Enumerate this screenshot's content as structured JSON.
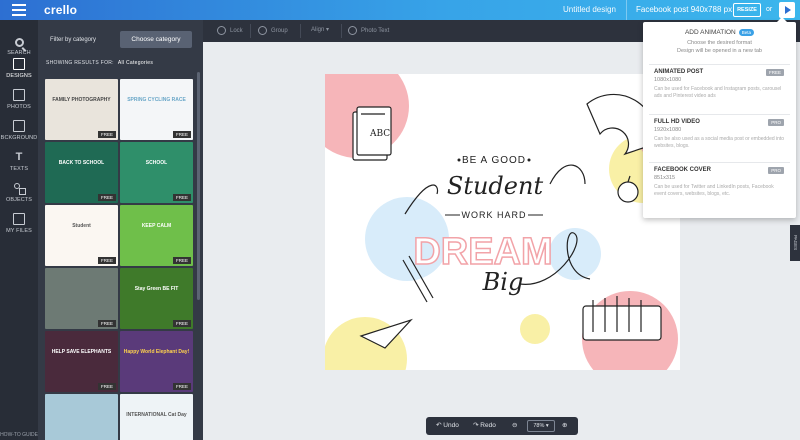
{
  "topbar": {
    "logo": "crello",
    "document_title": "Untitled design",
    "format": "Facebook post 940x788 px",
    "resize_label": "RESIZE",
    "or_label": "or"
  },
  "nav": [
    {
      "label": "SEARCH",
      "icon": "search-icon"
    },
    {
      "label": "DESIGNS",
      "icon": "designs-icon"
    },
    {
      "label": "PHOTOS",
      "icon": "photos-icon"
    },
    {
      "label": "BCKGROUND",
      "icon": "background-icon"
    },
    {
      "label": "TEXTS",
      "icon": "text-icon"
    },
    {
      "label": "OBJECTS",
      "icon": "objects-icon"
    },
    {
      "label": "MY FILES",
      "icon": "folder-icon"
    }
  ],
  "howto": "HOW-TO GUIDE",
  "panel": {
    "filter_label": "Filter by category",
    "choose_button": "Choose category",
    "results_label": "SHOWING RESULTS FOR:",
    "results_value": "All Categories",
    "free_badge": "FREE",
    "tiles": [
      {
        "text": "FAMILY PHOTOGRAPHY",
        "bg": "#e9e4dc",
        "fg": "#444"
      },
      {
        "text": "SPRING CYCLING RACE",
        "bg": "#f4f6f8",
        "fg": "#6aa7c8"
      },
      {
        "text": "BACK TO SCHOOL",
        "bg": "#1f6a54",
        "fg": "#ffffff"
      },
      {
        "text": "SCHOOL",
        "bg": "#2f8f6a",
        "fg": "#ffffff"
      },
      {
        "text": "Student",
        "bg": "#fbf7f2",
        "fg": "#555"
      },
      {
        "text": "KEEP CALM",
        "bg": "#6fbf4a",
        "fg": "#ffffff"
      },
      {
        "text": "",
        "bg": "#6d7a74",
        "fg": "#fff"
      },
      {
        "text": "Stay Green BE FIT",
        "bg": "#3f7a2a",
        "fg": "#ffffff"
      },
      {
        "text": "HELP SAVE ELEPHANTS",
        "bg": "#4a2a3c",
        "fg": "#ffffff"
      },
      {
        "text": "Happy World Elephant Day!",
        "bg": "#5a3a7a",
        "fg": "#ffd34d"
      },
      {
        "text": "",
        "bg": "#a8c9d8",
        "fg": "#fff"
      },
      {
        "text": "INTERNATIONAL Cat Day",
        "bg": "#eef3f6",
        "fg": "#555"
      }
    ]
  },
  "toolbar": {
    "lock": "Lock",
    "group": "Group",
    "align": "Align",
    "photo_text": "Photo Text"
  },
  "canvas": {
    "be_a_good": "BE A GOOD",
    "student": "Student",
    "work_hard": "WORK HARD",
    "dream": "DREAM",
    "big": "Big",
    "book_letters": "ABC"
  },
  "pages_tab": "PAGES",
  "bottom": {
    "undo": "Undo",
    "redo": "Redo",
    "zoom": "78%"
  },
  "dropdown": {
    "title": "ADD ANIMATION",
    "beta": "Beta",
    "subtitle_1": "Choose the desired format",
    "subtitle_2": "Design will be opened in a new tab",
    "options": [
      {
        "name": "ANIMATED POST",
        "badge": "FREE",
        "size": "1080x1080",
        "desc": "Can be used for Facebook and Instagram posts, carousel ads and Pinterest video ads"
      },
      {
        "name": "FULL HD VIDEO",
        "badge": "PRO",
        "size": "1920x1080",
        "desc": "Can be also used as a social media post or embedded into websites, blogs."
      },
      {
        "name": "FACEBOOK COVER",
        "badge": "PRO",
        "size": "851x315",
        "desc": "Can be used for Twitter and LinkedIn posts, Facebook event covers, websites, blogs, etc."
      }
    ]
  },
  "colors": {
    "accent": "#3ba1e6",
    "pink": "#f6b5b9",
    "yellow": "#f9f0a6",
    "blue": "#d8ecfa",
    "dream": "#f2a3a8"
  }
}
